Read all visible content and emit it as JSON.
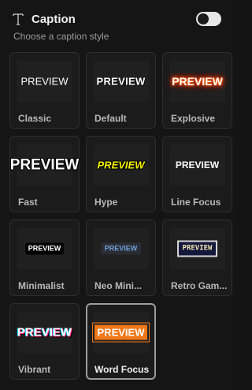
{
  "header": {
    "title": "Caption",
    "subtitle": "Choose a caption style",
    "toggle_on": true,
    "icon": "text-icon"
  },
  "styles": [
    {
      "label": "Classic",
      "preview": "PREVIEW"
    },
    {
      "label": "Default",
      "preview": "PREVIEW"
    },
    {
      "label": "Explosive",
      "preview": "PREVIEW"
    },
    {
      "label": "Fast",
      "preview": "PREVIEW"
    },
    {
      "label": "Hype",
      "preview": "PREVIEW"
    },
    {
      "label": "Line Focus",
      "preview": "PREVIEW"
    },
    {
      "label": "Minimalist",
      "preview": "PREVIEW"
    },
    {
      "label": "Neo Mini...",
      "preview": "PREVIEW"
    },
    {
      "label": "Retro Gam...",
      "preview": "PREVIEW"
    },
    {
      "label": "Vibrant",
      "preview": "PREVIEW"
    },
    {
      "label": "Word Focus",
      "preview": "PREVIEW"
    }
  ],
  "selected_style": "Word Focus",
  "colors": {
    "background": "#151515",
    "hype_yellow": "#f5f500",
    "explosive_glow": "#ff4500",
    "word_focus_orange": "#f07818",
    "neo_blue": "#6fa0d8"
  }
}
